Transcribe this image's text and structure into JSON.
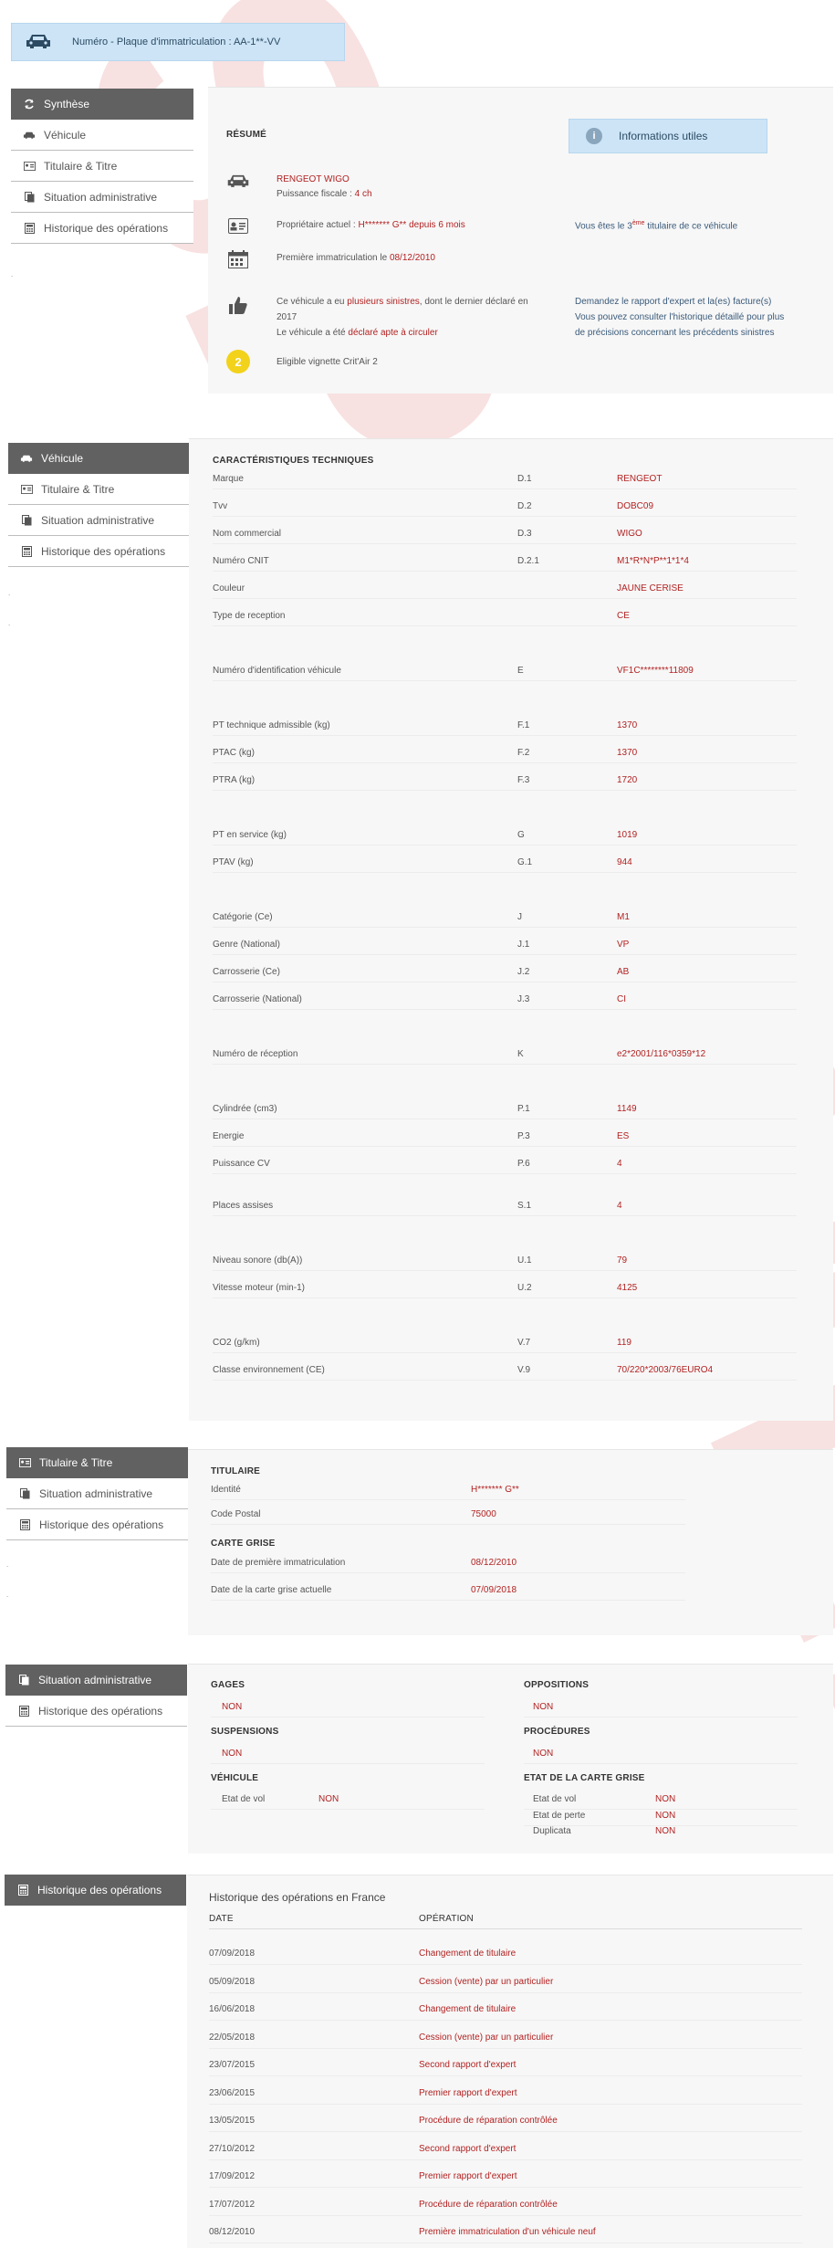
{
  "header": {
    "plate_label": "Numéro - Plaque d'immatriculation : AA-1**-VV"
  },
  "watermark": {
    "text": "SPECIMEN",
    "color": "#f3c9c9"
  },
  "colors": {
    "accent_red": "#b22222",
    "menu_active": "#616161",
    "info_blue": "#cce4f6"
  },
  "menus": {
    "m1": [
      {
        "label": "Synthèse",
        "icon": "refresh-icon",
        "active": true
      },
      {
        "label": "Véhicule",
        "icon": "car-icon"
      },
      {
        "label": "Titulaire & Titre",
        "icon": "id-card-icon"
      },
      {
        "label": "Situation administrative",
        "icon": "documents-icon"
      },
      {
        "label": "Historique des opérations",
        "icon": "calculator-icon"
      }
    ],
    "m2": [
      {
        "label": "Véhicule",
        "icon": "car-icon",
        "active": true
      },
      {
        "label": "Titulaire & Titre",
        "icon": "id-card-icon"
      },
      {
        "label": "Situation administrative",
        "icon": "documents-icon"
      },
      {
        "label": "Historique des opérations",
        "icon": "calculator-icon"
      }
    ],
    "m3": [
      {
        "label": "Titulaire & Titre",
        "icon": "id-card-icon",
        "active": true
      },
      {
        "label": "Situation administrative",
        "icon": "documents-icon"
      },
      {
        "label": "Historique des opérations",
        "icon": "calculator-icon"
      }
    ],
    "m4": [
      {
        "label": "Situation administrative",
        "icon": "documents-icon",
        "active": true
      },
      {
        "label": "Historique des opérations",
        "icon": "calculator-icon"
      }
    ],
    "m5": [
      {
        "label": "Historique des opérations",
        "icon": "calculator-icon",
        "active": true
      }
    ],
    "dots": "."
  },
  "summary": {
    "title": "RÉSUMÉ",
    "info_button": "Informations utiles",
    "model": "RENGEOT WIGO",
    "power_label": "Puissance fiscale : ",
    "power_value": "4 ch",
    "owner_label": "Propriétaire actuel : ",
    "owner_value": "H******* G** depuis 6 mois",
    "owner_rank_pre": "Vous êtes le 3",
    "owner_rank_sup": "ème",
    "owner_rank_post": " titulaire de ce véhicule",
    "first_reg_label": "Première immatriculation le ",
    "first_reg_value": "08/12/2010",
    "sinistre_pre": "Ce véhicule a eu ",
    "sinistre_link": "plusieurs sinistres",
    "sinistre_post": ", dont le dernier déclaré en",
    "sinistre_year": "2017",
    "apt_pre": "Le véhicule a été ",
    "apt_link": "déclaré apte à circuler",
    "expert_1": "Demandez le rapport d'expert et la(es) facture(s)",
    "expert_2": "Vous pouvez consulter l'historique détaillé pour plus",
    "expert_3": "de précisions concernant les précédents sinistres",
    "critair": "Eligible vignette Crit'Air 2"
  },
  "tech": {
    "title": "CARACTÉRISTIQUES TECHNIQUES",
    "rows": [
      {
        "label": "Marque",
        "code": "D.1",
        "value": "RENGEOT"
      },
      {
        "label": "Tvv",
        "code": "D.2",
        "value": "DOBC09"
      },
      {
        "label": "Nom commercial",
        "code": "D.3",
        "value": "WIGO"
      },
      {
        "label": "Numéro CNIT",
        "code": "D.2.1",
        "value": "M1*R*N*P**1*1*4"
      },
      {
        "label": "Couleur",
        "code": "",
        "value": "JAUNE CERISE"
      },
      {
        "label": "Type de reception",
        "code": "",
        "value": "CE"
      },
      {
        "label": "Numéro d'identification véhicule",
        "code": "E",
        "value": "VF1C********11809"
      },
      {
        "label": "PT technique admissible (kg)",
        "code": "F.1",
        "value": "1370"
      },
      {
        "label": "PTAC (kg)",
        "code": "F.2",
        "value": "1370"
      },
      {
        "label": "PTRA (kg)",
        "code": "F.3",
        "value": "1720"
      },
      {
        "label": "PT en service (kg)",
        "code": "G",
        "value": "1019"
      },
      {
        "label": "PTAV (kg)",
        "code": "G.1",
        "value": "944"
      },
      {
        "label": "Catégorie (Ce)",
        "code": "J",
        "value": "M1"
      },
      {
        "label": "Genre (National)",
        "code": "J.1",
        "value": "VP"
      },
      {
        "label": "Carrosserie (Ce)",
        "code": "J.2",
        "value": "AB"
      },
      {
        "label": "Carrosserie (National)",
        "code": "J.3",
        "value": "CI"
      },
      {
        "label": "Numéro de réception",
        "code": "K",
        "value": "e2*2001/116*0359*12"
      },
      {
        "label": "Cylindrée (cm3)",
        "code": "P.1",
        "value": "1149"
      },
      {
        "label": "Energie",
        "code": "P.3",
        "value": "ES"
      },
      {
        "label": "Puissance CV",
        "code": "P.6",
        "value": "4"
      },
      {
        "label": "Places assises",
        "code": "S.1",
        "value": "4"
      },
      {
        "label": "Niveau sonore (db(A))",
        "code": "U.1",
        "value": "79"
      },
      {
        "label": "Vitesse moteur (min-1)",
        "code": "U.2",
        "value": "4125"
      },
      {
        "label": "CO2 (g/km)",
        "code": "V.7",
        "value": "119"
      },
      {
        "label": "Classe environnement (CE)",
        "code": "V.9",
        "value": "70/220*2003/76EURO4"
      }
    ]
  },
  "titulaire": {
    "title": "TITULAIRE",
    "identity_label": "Identité",
    "identity_value": "H******* G**",
    "postal_label": "Code Postal",
    "postal_value": "75000",
    "card_title": "CARTE GRISE",
    "first_reg_label": "Date de première immatriculation",
    "first_reg_value": "08/12/2010",
    "current_card_label": "Date de la carte grise actuelle",
    "current_card_value": "07/09/2018"
  },
  "admin": {
    "gages_title": "GAGES",
    "gages_value": "NON",
    "oppositions_title": "OPPOSITIONS",
    "oppositions_value": "NON",
    "suspensions_title": "SUSPENSIONS",
    "suspensions_value": "NON",
    "procedures_title": "PROCÉDURES",
    "procedures_value": "NON",
    "vehicule_title": "VÉHICULE",
    "vol_label": "Etat de vol",
    "vol_value": "NON",
    "carte_title": "ETAT DE LA CARTE GRISE",
    "carte_vol_label": "Etat de vol",
    "carte_vol_value": "NON",
    "carte_perte_label": "Etat de perte",
    "carte_perte_value": "NON",
    "duplicata_label": "Duplicata",
    "duplicata_value": "NON"
  },
  "history": {
    "title": "Historique des opérations en France",
    "col_date": "DATE",
    "col_op": "OPÉRATION",
    "rows": [
      {
        "date": "07/09/2018",
        "op": "Changement de titulaire"
      },
      {
        "date": "05/09/2018",
        "op": "Cession (vente) par un particulier"
      },
      {
        "date": "16/06/2018",
        "op": "Changement de titulaire"
      },
      {
        "date": "22/05/2018",
        "op": "Cession (vente) par un particulier"
      },
      {
        "date": "23/07/2015",
        "op": "Second rapport d'expert"
      },
      {
        "date": "23/06/2015",
        "op": "Premier rapport d'expert"
      },
      {
        "date": "13/05/2015",
        "op": "Procédure de réparation contrôlée"
      },
      {
        "date": "27/10/2012",
        "op": "Second rapport d'expert"
      },
      {
        "date": "17/09/2012",
        "op": "Premier rapport d'expert"
      },
      {
        "date": "17/07/2012",
        "op": "Procédure de réparation contrôlée"
      },
      {
        "date": "08/12/2010",
        "op": "Première immatriculation d'un véhicule neuf"
      }
    ]
  }
}
